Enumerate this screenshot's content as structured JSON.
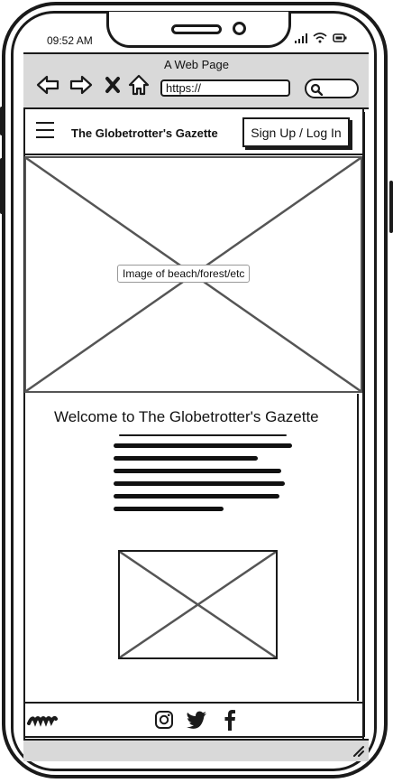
{
  "status_bar": {
    "time": "09:52 AM",
    "icons": [
      "signal-icon",
      "wifi-icon",
      "battery-icon"
    ]
  },
  "browser": {
    "title": "A Web Page",
    "url": "https://",
    "nav_icons": [
      "back-arrow-icon",
      "forward-arrow-icon",
      "close-icon",
      "home-icon"
    ],
    "search_icon": "search-icon"
  },
  "header": {
    "site_title": "The Globetrotter's Gazette",
    "auth_button": "Sign Up / Log In",
    "menu_icon": "hamburger-menu-icon"
  },
  "hero": {
    "label": "Image of beach/forest/etc"
  },
  "content": {
    "heading": "Welcome to The Globetrotter's Gazette"
  },
  "footer": {
    "social_icons": [
      "instagram-icon",
      "twitter-icon",
      "facebook-icon"
    ],
    "logo": "squiggle-logo-icon"
  },
  "colors": {
    "chrome": "#d9d9d9",
    "ink": "#1a1a1a",
    "placeholder": "#555555"
  }
}
